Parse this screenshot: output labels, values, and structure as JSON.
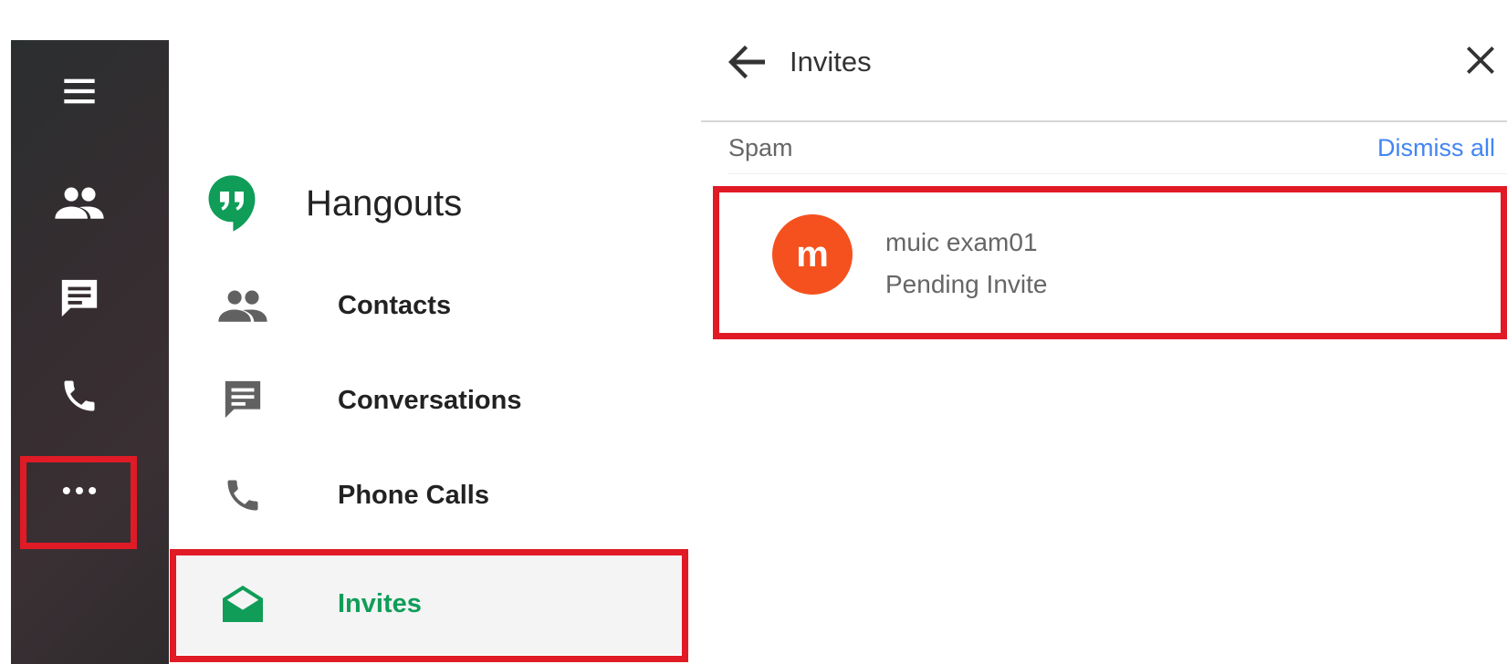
{
  "rail": {
    "items": [
      {
        "name": "menu-icon"
      },
      {
        "name": "people-icon"
      },
      {
        "name": "chat-icon"
      },
      {
        "name": "phone-icon"
      },
      {
        "name": "more-icon"
      }
    ]
  },
  "nav": {
    "brand": "Hangouts",
    "items": [
      {
        "label": "Contacts",
        "icon": "people-icon"
      },
      {
        "label": "Conversations",
        "icon": "chat-icon"
      },
      {
        "label": "Phone Calls",
        "icon": "phone-icon"
      },
      {
        "label": "Invites",
        "icon": "envelope-open-icon",
        "active": true
      }
    ]
  },
  "panel": {
    "title": "Invites",
    "section": "Spam",
    "dismiss_label": "Dismiss all",
    "invites": [
      {
        "avatar_letter": "m",
        "name": "muic exam01",
        "status": "Pending Invite"
      }
    ]
  },
  "colors": {
    "accent_green": "#0f9d58",
    "link_blue": "#4285f4",
    "avatar_orange": "#f4511e",
    "highlight_red": "#e01b25"
  }
}
